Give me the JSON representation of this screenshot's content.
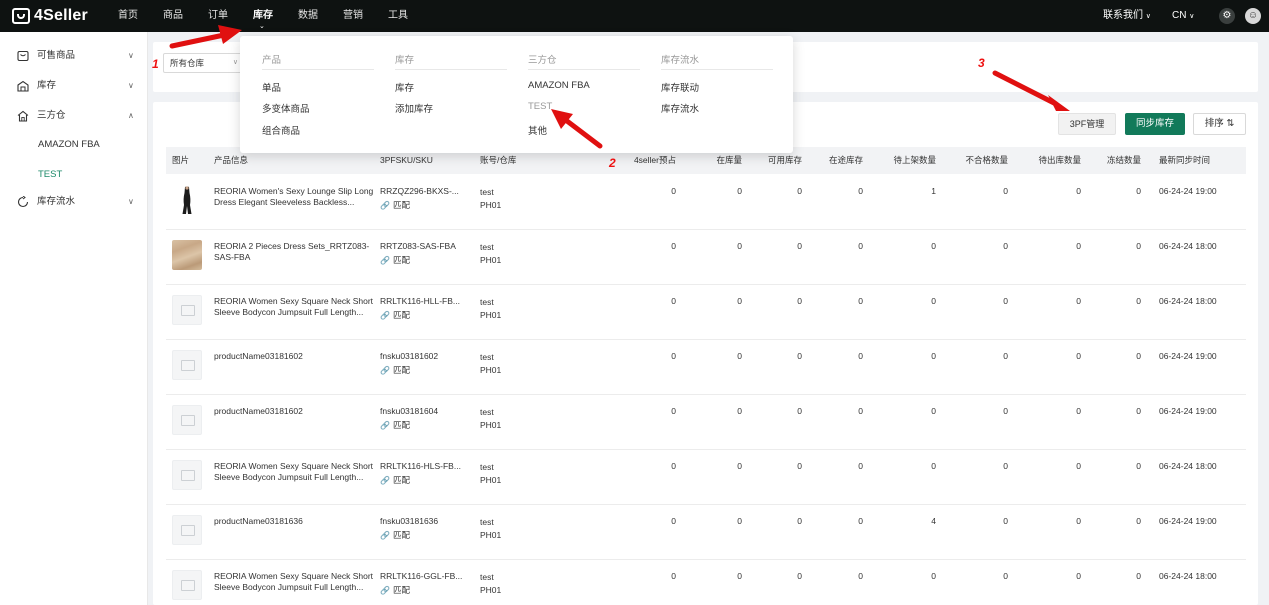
{
  "app": {
    "logo_text": "4Seller"
  },
  "topnav": {
    "items": [
      {
        "label": "首页",
        "active": false
      },
      {
        "label": "商品",
        "active": false
      },
      {
        "label": "订单",
        "active": false
      },
      {
        "label": "库存",
        "active": true
      },
      {
        "label": "数据",
        "active": false
      },
      {
        "label": "营销",
        "active": false
      },
      {
        "label": "工具",
        "active": false
      }
    ],
    "contact_label": "联系我们",
    "lang_label": "CN"
  },
  "sidebar": {
    "items": [
      {
        "label": "可售商品",
        "icon": "product-icon",
        "chevron": "∨"
      },
      {
        "label": "库存",
        "icon": "inventory-icon",
        "chevron": "∨"
      },
      {
        "label": "三方仓",
        "icon": "warehouse-icon",
        "chevron": "∧"
      },
      {
        "label": "库存流水",
        "icon": "flow-icon",
        "chevron": "∨"
      }
    ],
    "subitems": [
      {
        "label": "AMAZON FBA",
        "active": false
      },
      {
        "label": "TEST",
        "active": true
      }
    ]
  },
  "filter": {
    "warehouse_value": "所有仓库"
  },
  "dropdown": {
    "columns": [
      {
        "heading": "产品",
        "items": [
          "单品",
          "多变体商品",
          "组合商品"
        ]
      },
      {
        "heading": "库存",
        "items": [
          "库存",
          "添加库存"
        ]
      },
      {
        "heading": "三方仓",
        "items": [
          "AMAZON FBA",
          "TEST",
          "其他"
        ]
      },
      {
        "heading": "库存流水",
        "items": [
          "库存联动",
          "库存流水"
        ]
      }
    ]
  },
  "toolbar": {
    "btn_3pf": "3PF管理",
    "btn_sync": "同步库存",
    "btn_sort": "排序"
  },
  "table": {
    "headers": [
      "图片",
      "产品信息",
      "3PFSKU/SKU",
      "账号/仓库",
      "4seller预占",
      "在库量",
      "可用库存",
      "在途库存",
      "待上架数量",
      "不合格数量",
      "待出库数量",
      "冻结数量",
      "最新同步时间"
    ],
    "match_label": "匹配",
    "rows": [
      {
        "image": "dress",
        "name": "REORIA Women's Sexy Lounge Slip Long Dress Elegant Sleeveless Backless...",
        "sku": "RRZQZ296-BKXS-...",
        "account": "test",
        "warehouse": "PH01",
        "reserved": "0",
        "on_hand": "0",
        "available": "0",
        "in_transit": "0",
        "pending_shelf": "1",
        "unqualified": "0",
        "pending_out": "0",
        "frozen": "0",
        "sync_time": "06-24-24 19:00"
      },
      {
        "image": "fabric",
        "name": "REORIA 2 Pieces Dress Sets_RRTZ083-SAS-FBA",
        "sku": "RRTZ083-SAS-FBA",
        "account": "test",
        "warehouse": "PH01",
        "reserved": "0",
        "on_hand": "0",
        "available": "0",
        "in_transit": "0",
        "pending_shelf": "0",
        "unqualified": "0",
        "pending_out": "0",
        "frozen": "0",
        "sync_time": "06-24-24 18:00"
      },
      {
        "image": "placeholder",
        "name": "REORIA Women Sexy Square Neck Short Sleeve Bodycon Jumpsuit Full Length...",
        "sku": "RRLTK116-HLL-FB...",
        "account": "test",
        "warehouse": "PH01",
        "reserved": "0",
        "on_hand": "0",
        "available": "0",
        "in_transit": "0",
        "pending_shelf": "0",
        "unqualified": "0",
        "pending_out": "0",
        "frozen": "0",
        "sync_time": "06-24-24 18:00"
      },
      {
        "image": "placeholder",
        "name": "productName03181602",
        "sku": "fnsku03181602",
        "account": "test",
        "warehouse": "PH01",
        "reserved": "0",
        "on_hand": "0",
        "available": "0",
        "in_transit": "0",
        "pending_shelf": "0",
        "unqualified": "0",
        "pending_out": "0",
        "frozen": "0",
        "sync_time": "06-24-24 19:00"
      },
      {
        "image": "placeholder",
        "name": "productName03181602",
        "sku": "fnsku03181604",
        "account": "test",
        "warehouse": "PH01",
        "reserved": "0",
        "on_hand": "0",
        "available": "0",
        "in_transit": "0",
        "pending_shelf": "0",
        "unqualified": "0",
        "pending_out": "0",
        "frozen": "0",
        "sync_time": "06-24-24 19:00"
      },
      {
        "image": "placeholder",
        "name": "REORIA Women Sexy Square Neck Short Sleeve Bodycon Jumpsuit Full Length...",
        "sku": "RRLTK116-HLS-FB...",
        "account": "test",
        "warehouse": "PH01",
        "reserved": "0",
        "on_hand": "0",
        "available": "0",
        "in_transit": "0",
        "pending_shelf": "0",
        "unqualified": "0",
        "pending_out": "0",
        "frozen": "0",
        "sync_time": "06-24-24 18:00"
      },
      {
        "image": "placeholder",
        "name": "productName03181636",
        "sku": "fnsku03181636",
        "account": "test",
        "warehouse": "PH01",
        "reserved": "0",
        "on_hand": "0",
        "available": "0",
        "in_transit": "0",
        "pending_shelf": "4",
        "unqualified": "0",
        "pending_out": "0",
        "frozen": "0",
        "sync_time": "06-24-24 19:00"
      },
      {
        "image": "placeholder",
        "name": "REORIA Women Sexy Square Neck Short Sleeve Bodycon Jumpsuit Full Length...",
        "sku": "RRLTK116-GGL-FB...",
        "account": "test",
        "warehouse": "PH01",
        "reserved": "0",
        "on_hand": "0",
        "available": "0",
        "in_transit": "0",
        "pending_shelf": "0",
        "unqualified": "0",
        "pending_out": "0",
        "frozen": "0",
        "sync_time": "06-24-24 18:00"
      }
    ]
  },
  "annotations": {
    "labels": [
      "1",
      "2",
      "3"
    ],
    "color": "#e01010"
  },
  "colors": {
    "topbar": "#0e1211",
    "accent_green": "#127a5a",
    "active_sub": "#1d8a6a"
  }
}
